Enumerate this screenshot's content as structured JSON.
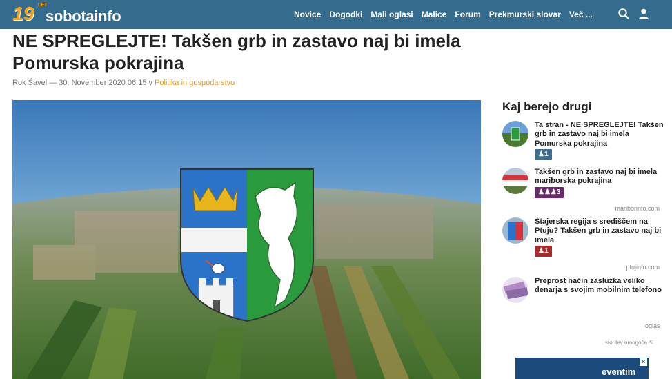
{
  "header": {
    "logo_number": "19",
    "logo_let": "LET",
    "logo_text": "sobotainfo",
    "nav": [
      "Novice",
      "Dogodki",
      "Mali oglasi",
      "Malice",
      "Forum",
      "Prekmurski slovar",
      "Več ..."
    ]
  },
  "article": {
    "title": "NE SPREGLEJTE! Takšen grb in zastavo naj bi imela Pomurska pokrajina",
    "author": "Rok Šavel",
    "dash": "—",
    "date": "30. November 2020 06:15",
    "in_word": "v",
    "category": "Politika in gospodarstvo"
  },
  "sidebar": {
    "title": "Kaj berejo drugi",
    "items": [
      {
        "text": "Ta stran - NE SPREGLEJTE! Takšen grb in zastavo naj bi imela Pomurska pokrajina",
        "badge": "1",
        "badge_color": "#3d6e8f"
      },
      {
        "text": "Takšen grb in zastavo naj bi imela mariborska pokrajina",
        "badge": "3",
        "badge_color": "#6b2a6e",
        "source": "mariborinfo.com"
      },
      {
        "text": "Štajerska regija s središčem na Ptuju? Takšen grb in zastavo naj bi imela",
        "badge": "1",
        "badge_color": "#a82a2a",
        "source": "ptujinfo.com"
      },
      {
        "text": "Preprost način zaslužka veliko denarja s svojim mobilnim telefono"
      }
    ],
    "ad_label": "oglas",
    "ad_provider": "storitev omogoča",
    "ad_logo": "eventim"
  },
  "colors": {
    "topbar": "#356b8c",
    "logo_orange": "#f2a31b",
    "category": "#e89a1c"
  }
}
